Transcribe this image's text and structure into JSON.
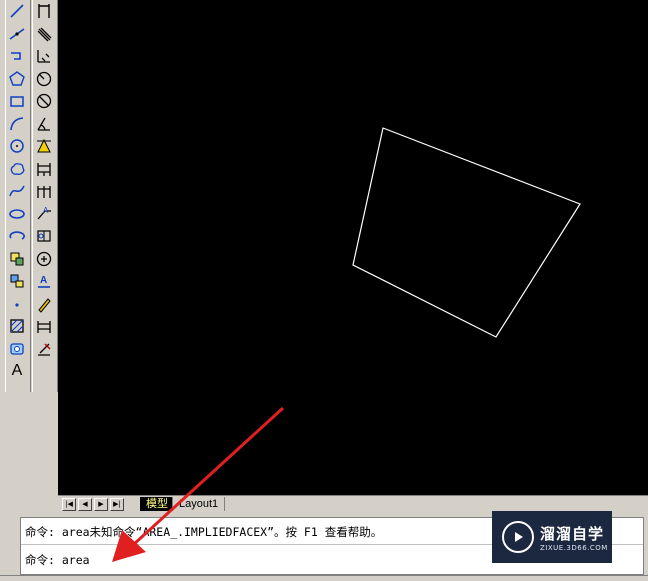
{
  "draw_toolbar": {
    "tools": [
      "line-icon",
      "xline-icon",
      "polyline-icon",
      "polygon-icon",
      "rectangle-icon",
      "arc-icon",
      "circle-icon",
      "revcloud-icon",
      "spline-icon",
      "ellipse-icon",
      "ellipse-arc-icon",
      "insert-block-icon",
      "make-block-icon",
      "point-icon",
      "hatch-icon",
      "region-icon",
      "multiline-text-icon"
    ],
    "text_tool_label": "A"
  },
  "modify_toolbar": {
    "tools": [
      "dim-linear-icon",
      "dim-aligned-icon",
      "dim-ordinate-icon",
      "dim-radius-icon",
      "dim-diameter-icon",
      "dim-angular-icon",
      "quick-dim-icon",
      "dim-baseline-icon",
      "dim-continue-icon",
      "quick-leader-icon",
      "tolerance-icon",
      "center-mark-icon",
      "dim-edit-icon",
      "dim-text-edit-icon",
      "dim-update-icon",
      "dim-style-icon"
    ]
  },
  "tabs": {
    "model_label": "模型",
    "layout1_label": "Layout1"
  },
  "command": {
    "history_line": "命令: area未知命令“AREA_.IMPLIEDFACEX”。按 F1 查看帮助。",
    "current_line": "命令: area"
  },
  "watermark": {
    "brand": "溜溜自学",
    "url": "ZIXUE.3D66.COM"
  },
  "colors": {
    "canvas": "#000000",
    "geometry": "#ffffff",
    "arrow": "#e02020",
    "chrome": "#d4d0c8",
    "model_tab_text": "#ffff80"
  }
}
